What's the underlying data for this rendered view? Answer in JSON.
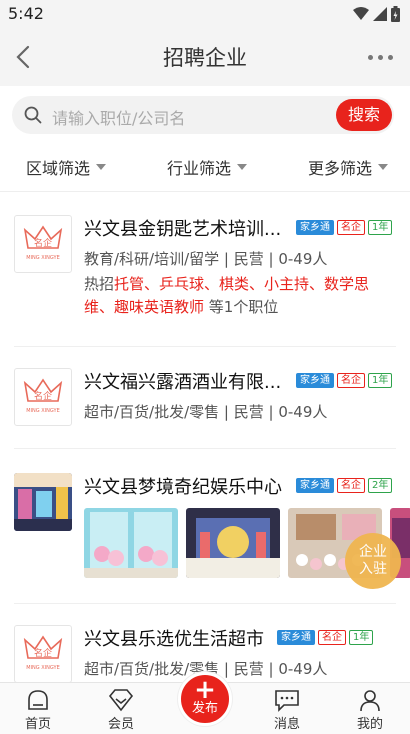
{
  "status": {
    "time": "5:42"
  },
  "nav": {
    "title": "招聘企业"
  },
  "search": {
    "placeholder": "请输入职位/公司名",
    "button": "搜索"
  },
  "filters": [
    "区域筛选",
    "行业筛选",
    "更多筛选"
  ],
  "logo_text": {
    "cn": "名企",
    "en": "MING XINGYE"
  },
  "companies": [
    {
      "name": "兴文县金钥匙艺术培训...",
      "tags": [
        "家乡通",
        "名企",
        "1年"
      ],
      "meta": "教育/科研/培训/留学 | 民营 | 0-49人",
      "jobs_prefix": "热招",
      "jobs_list": "托管、乒乓球、棋类、小主持、数学思维、趣味英语教师",
      "jobs_suffix": " 等1个职位"
    },
    {
      "name": "兴文福兴露酒酒业有限...",
      "tags": [
        "家乡通",
        "名企",
        "1年"
      ],
      "meta": "超市/百货/批发/零售 | 民营 | 0-49人"
    },
    {
      "name": "兴文县梦境奇纪娱乐中心",
      "tags": [
        "家乡通",
        "名企",
        "2年"
      ]
    },
    {
      "name": "兴文县乐选优生活超市",
      "tags": [
        "家乡通",
        "名企",
        "1年"
      ],
      "meta": "超市/百货/批发/零售 | 民营 | 0-49人"
    }
  ],
  "float_button": {
    "line1": "企业",
    "line2": "入驻"
  },
  "tabbar": {
    "home": "首页",
    "member": "会员",
    "publish": "发布",
    "messages": "消息",
    "mine": "我的"
  },
  "colors": {
    "accent": "#e8231c",
    "tag_blue": "#2a8bd9",
    "tag_green": "#2ea34b",
    "float": "#f0b650"
  }
}
